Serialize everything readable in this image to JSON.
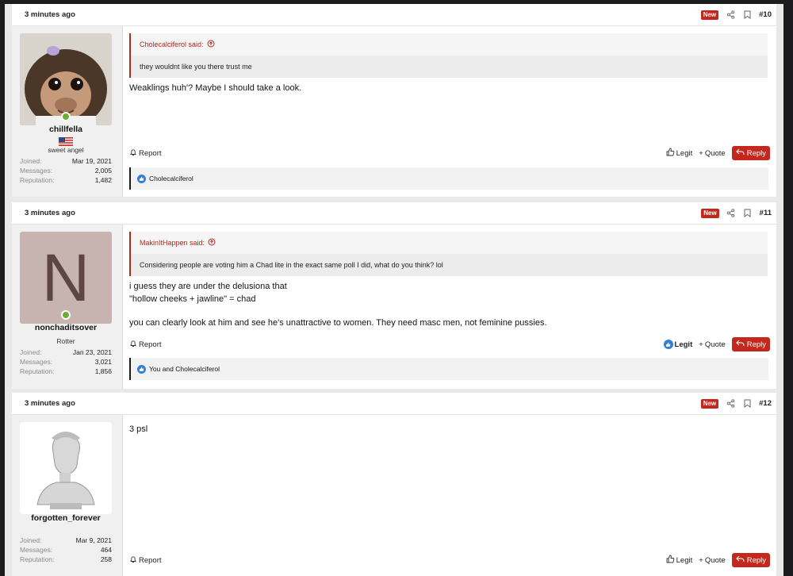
{
  "posts": [
    {
      "time": "3 minutes ago",
      "new_badge": "New",
      "number": "#10",
      "user": {
        "name": "chillfella",
        "title": "sweet angel",
        "avatar": "monkey-avatar",
        "stats": [
          {
            "label": "Joined:",
            "value": "Mar 19, 2021"
          },
          {
            "label": "Messages:",
            "value": "2,005"
          },
          {
            "label": "Reputation:",
            "value": "1,482"
          }
        ]
      },
      "quote": {
        "author": "Cholecalciferol said:",
        "text": "they wouldnt like you there trust me"
      },
      "message": [
        "Weaklings huh'? Maybe I should take a look."
      ],
      "report": "Report",
      "legit": "Legit",
      "quote_btn": "Quote",
      "reply": "Reply",
      "reactions": "Cholecalciferol"
    },
    {
      "time": "3 minutes ago",
      "new_badge": "New",
      "number": "#11",
      "user": {
        "name": "nonchaditsover",
        "title": "Rotter",
        "avatar_letter": "N",
        "stats": [
          {
            "label": "Joined:",
            "value": "Jan 23, 2021"
          },
          {
            "label": "Messages:",
            "value": "3,021"
          },
          {
            "label": "Reputation:",
            "value": "1,856"
          }
        ]
      },
      "quote": {
        "author": "MakinItHappen said:",
        "text": "Considering people are voting him a Chad lite in the exact same poll I did, what do you think? lol"
      },
      "message": [
        "i guess they are under the delusiona that",
        "\"hollow cheeks + jawline\" = chad",
        "",
        "you can clearly look at him and see he's unattractive to women. They need masc men, not feminine pussies."
      ],
      "report": "Report",
      "legit": "Legit",
      "quote_btn": "Quote",
      "reply": "Reply",
      "reactions": "You and Cholecalciferol"
    },
    {
      "time": "3 minutes ago",
      "new_badge": "New",
      "number": "#12",
      "user": {
        "name": "forgotten_forever",
        "avatar": "statue-avatar",
        "stats": [
          {
            "label": "Joined:",
            "value": "Mar 9, 2021"
          },
          {
            "label": "Messages:",
            "value": "464"
          },
          {
            "label": "Reputation:",
            "value": "258"
          }
        ]
      },
      "message": [
        "3 psl"
      ],
      "report": "Report",
      "legit": "Legit",
      "quote_btn": "Quote",
      "reply": "Reply"
    }
  ],
  "colors": {
    "accent": "#c4281c",
    "like": "#2f7fe0",
    "online": "#6aae35"
  }
}
